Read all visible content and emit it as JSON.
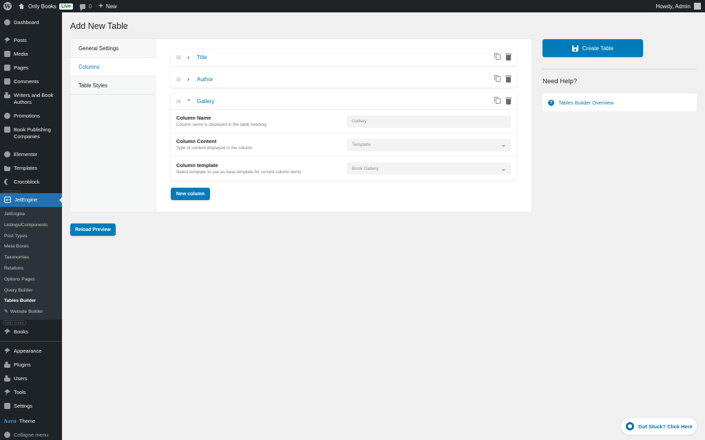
{
  "admin_bar": {
    "site_name": "Only Books",
    "live_badge": "Live",
    "comments_count": "0",
    "new_label": "New",
    "greeting": "Howdy, Admin"
  },
  "sidebar": {
    "items_top": [
      {
        "label": "Dashboard",
        "icon": "dashboard-icon"
      },
      {
        "label": "Posts",
        "icon": "pin-icon"
      },
      {
        "label": "Media",
        "icon": "media-icon"
      },
      {
        "label": "Pages",
        "icon": "pages-icon"
      },
      {
        "label": "Comments",
        "icon": "comments-icon"
      },
      {
        "label": "Writers and Book Authors",
        "icon": "users-icon"
      },
      {
        "label": "Promotions",
        "icon": "megaphone-icon"
      },
      {
        "label": "Book Publishing Companies",
        "icon": "edit-icon"
      },
      {
        "label": "Elementor",
        "icon": "elementor-icon"
      },
      {
        "label": "Templates",
        "icon": "folder-icon"
      },
      {
        "label": "Crocoblock",
        "icon": "crocoblock-icon"
      }
    ],
    "plugins_section_label": "PLUGINS",
    "current": {
      "label": "JetEngine",
      "icon_text": "JET"
    },
    "submenu": [
      {
        "label": "JetEngine"
      },
      {
        "label": "Listings/Components"
      },
      {
        "label": "Post Types"
      },
      {
        "label": "Meta Boxes"
      },
      {
        "label": "Taxonomies"
      },
      {
        "label": "Relations"
      },
      {
        "label": "Options Pages"
      },
      {
        "label": "Query Builder"
      },
      {
        "label": "Tables Builder",
        "active": true
      },
      {
        "label": "Website Builder"
      }
    ],
    "post_types_section_label": "POST TYPES",
    "books_label": "Books",
    "items_bottom": [
      {
        "label": "Appearance",
        "icon": "appearance-icon"
      },
      {
        "label": "Plugins",
        "icon": "plugins-icon"
      },
      {
        "label": "Users",
        "icon": "users-icon"
      },
      {
        "label": "Tools",
        "icon": "wrench-icon"
      },
      {
        "label": "Settings",
        "icon": "settings-icon"
      }
    ],
    "theme_logo": "hara",
    "theme_label": "Theme",
    "collapse_label": "Collapse menu"
  },
  "page": {
    "title": "Add New Table",
    "tabs": [
      {
        "label": "General Settings",
        "active": false
      },
      {
        "label": "Columns",
        "active": true
      },
      {
        "label": "Table Styles",
        "active": false
      }
    ],
    "columns": [
      {
        "title": "Title",
        "expanded": false
      },
      {
        "title": "Author",
        "expanded": false
      },
      {
        "title": "Gallery",
        "expanded": true
      }
    ],
    "gallery_fields": [
      {
        "name": "Column Name",
        "desc": "Column name is displayed in the table heading.",
        "value": "Gallery",
        "type": "text"
      },
      {
        "name": "Column Content",
        "desc": "Type of content displayed in the column",
        "value": "Template",
        "type": "select"
      },
      {
        "name": "Column template",
        "desc": "Select template to use as base template for current column items",
        "value": "Book Gallery",
        "type": "select"
      }
    ],
    "new_column_label": "New column",
    "reload_preview_label": "Reload Preview",
    "create_table_label": "Create Table",
    "help_title": "Need Help?",
    "help_link": "Tables Builder Overview",
    "stuck_label": "Got Stuck? Click Here"
  },
  "colors": {
    "accent": "#007cba",
    "admin_dark": "#1d2327",
    "menu_current": "#2271b1"
  }
}
